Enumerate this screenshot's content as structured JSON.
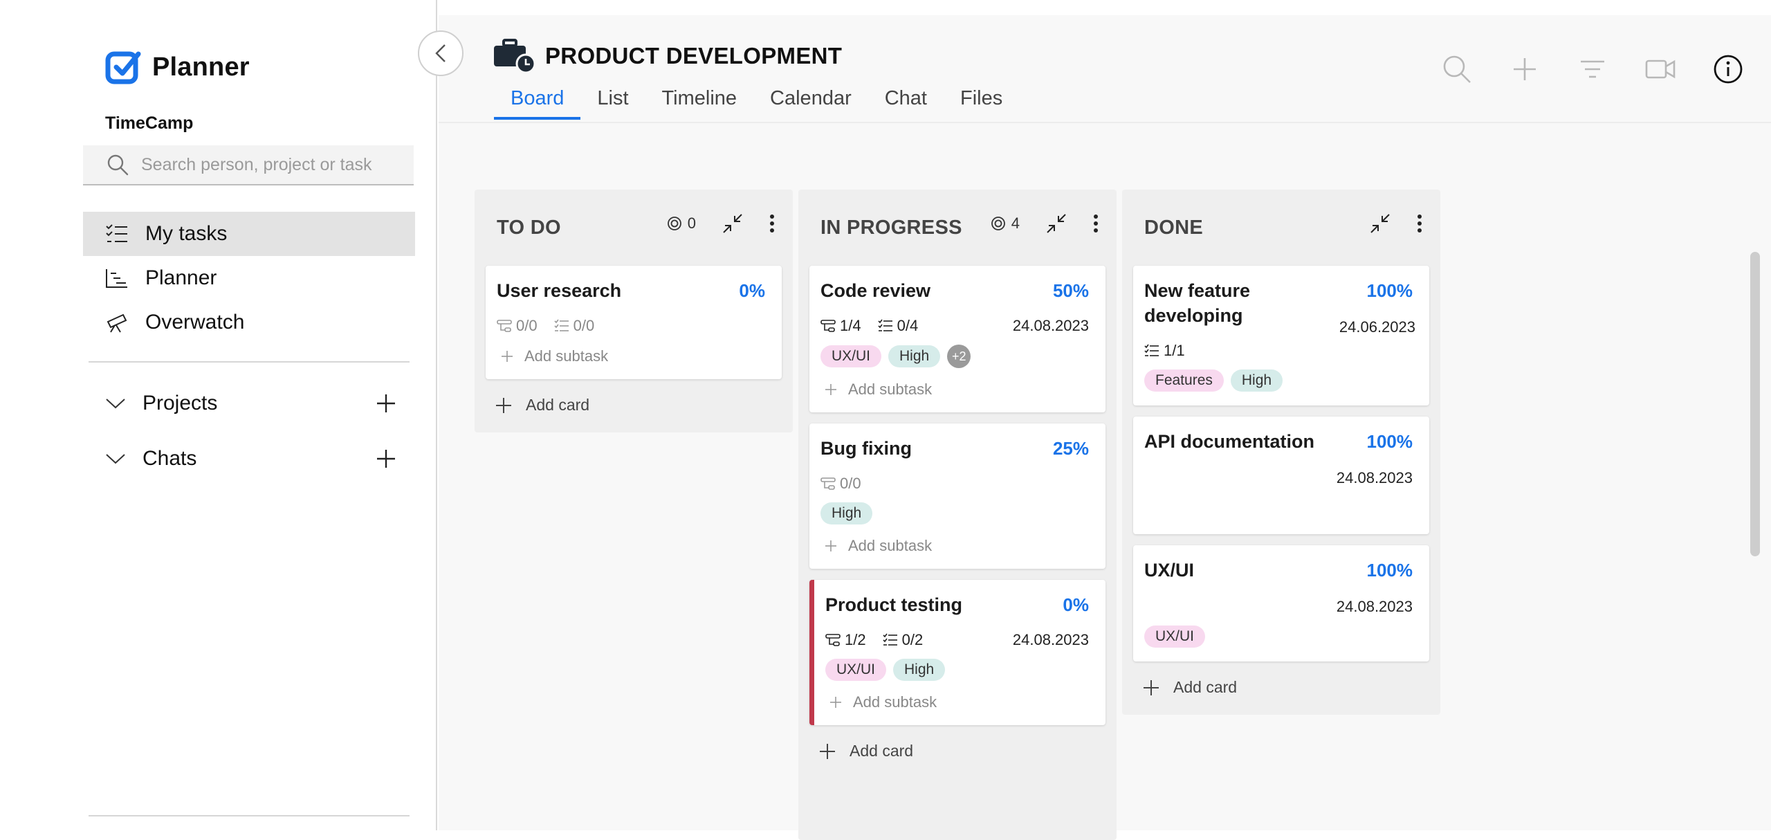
{
  "app": {
    "name": "Planner",
    "workspace": "TimeCamp",
    "brand_color": "#1a73e8"
  },
  "search": {
    "placeholder": "Search person, project or task"
  },
  "sidebar": {
    "items": [
      {
        "label": "My tasks",
        "icon": "list-check-icon",
        "active": true
      },
      {
        "label": "Planner",
        "icon": "chart-steps-icon",
        "active": false
      },
      {
        "label": "Overwatch",
        "icon": "telescope-icon",
        "active": false
      }
    ],
    "sections": [
      {
        "label": "Projects",
        "icon": "chevron-down-icon"
      },
      {
        "label": "Chats",
        "icon": "chevron-down-icon"
      }
    ]
  },
  "project": {
    "title": "PRODUCT DEVELOPMENT",
    "icon": "briefcase-clock-icon",
    "tabs": [
      "Board",
      "List",
      "Timeline",
      "Calendar",
      "Chat",
      "Files"
    ],
    "active_tab": "Board"
  },
  "toolbar": {
    "icons": [
      "search-icon",
      "plus-icon",
      "filter-icon",
      "video-icon",
      "info-icon"
    ]
  },
  "board": {
    "add_card_label": "Add card",
    "add_subtask_label": "Add subtask",
    "columns": [
      {
        "title": "TO DO",
        "count": "0",
        "cards": [
          {
            "title": "User research",
            "percent": "0%",
            "subtasks": "0/0",
            "checklist": "0/0"
          }
        ]
      },
      {
        "title": "IN PROGRESS",
        "count": "4",
        "cards": [
          {
            "title": "Code review",
            "percent": "50%",
            "subtasks": "1/4",
            "checklist": "0/4",
            "date": "24.08.2023",
            "tags": [
              "UX/UI",
              "High"
            ],
            "more": "+2"
          },
          {
            "title": "Bug fixing",
            "percent": "25%",
            "subtasks": "0/0",
            "tags": [
              "High"
            ]
          },
          {
            "title": "Product testing",
            "percent": "0%",
            "subtasks": "1/2",
            "checklist": "0/2",
            "date": "24.08.2023",
            "tags": [
              "UX/UI",
              "High"
            ],
            "flag_color": "#c0394b"
          }
        ]
      },
      {
        "title": "DONE",
        "cards": [
          {
            "title": "New feature developing",
            "percent": "100%",
            "date": "24.06.2023",
            "checklist": "1/1",
            "tags": [
              "Features",
              "High"
            ]
          },
          {
            "title": "API documentation",
            "percent": "100%",
            "date": "24.08.2023"
          },
          {
            "title": "UX/UI",
            "percent": "100%",
            "date": "24.08.2023",
            "tags": [
              "UX/UI"
            ]
          }
        ]
      }
    ]
  }
}
